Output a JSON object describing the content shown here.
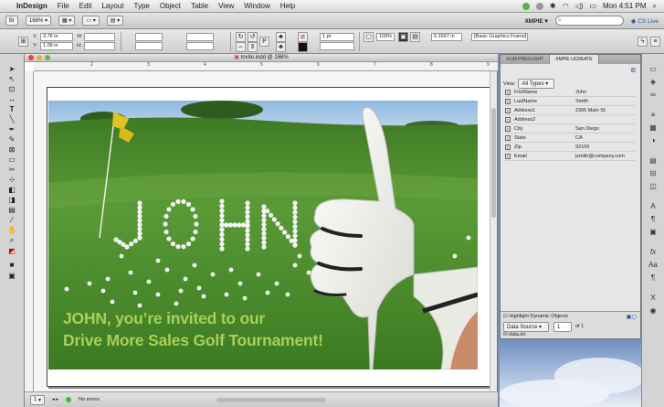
{
  "menubar": {
    "app": "InDesign",
    "items": [
      "File",
      "Edit",
      "Layout",
      "Type",
      "Object",
      "Table",
      "View",
      "Window",
      "Help"
    ],
    "clock": "Mon 4:51 PM"
  },
  "appbar": {
    "zoom": "166%",
    "workspace": "XMPIE",
    "cs_live": "CS Live"
  },
  "control": {
    "x_label": "X:",
    "x_value": "3.76 in",
    "y_label": "Y:",
    "y_value": "1.09 in",
    "w_label": "W:",
    "h_label": "H:",
    "stroke_weight": "1 pt",
    "opacity": "100%",
    "fill_offset": "0.1667 in",
    "frame_style": "[Basic Graphics Frame]"
  },
  "document": {
    "title": "Invite.indd @ 166%",
    "ruler_labels": [
      "2",
      "3",
      "4",
      "5",
      "6",
      "7",
      "8",
      "9"
    ],
    "headline_line1": "JOHN, you’re invited to our",
    "headline_line2": "Drive More Sales Golf Tournament!",
    "balls_text": "JOHN",
    "page_number": "1",
    "errors": "No errors"
  },
  "panel": {
    "tabs": [
      "XLIM PREFLIGHT",
      "XMPIE UCREATE"
    ],
    "view_label": "View:",
    "view_value": "All Types",
    "fields": [
      {
        "name": "FirstName",
        "value": "John"
      },
      {
        "name": "LastName",
        "value": "Smith"
      },
      {
        "name": "Address1",
        "value": "2365 Main St."
      },
      {
        "name": "Address2",
        "value": ""
      },
      {
        "name": "City",
        "value": "San Diego"
      },
      {
        "name": "State",
        "value": "CA"
      },
      {
        "name": "Zip",
        "value": "92109"
      },
      {
        "name": "Email",
        "value": "jsmith@company.com"
      }
    ],
    "highlight_label": "Highlight Dynamic Objects",
    "data_source": "Data Source",
    "record": "1",
    "record_of": "of 1",
    "data_file": "data.txt"
  },
  "colors": {
    "headline": "#a9d05a",
    "grass": "#4f8a2e",
    "sky": "#a6c6e3"
  }
}
